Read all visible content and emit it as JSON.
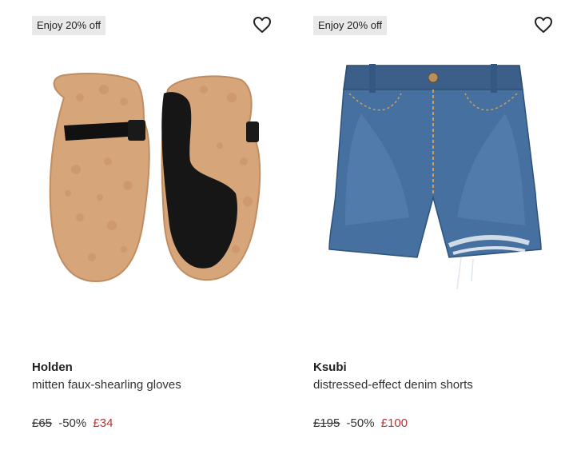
{
  "products": [
    {
      "promo": "Enjoy 20% off",
      "brand": "Holden",
      "name": "mitten faux-shearling gloves",
      "price": {
        "original": "£65",
        "discount": "-50%",
        "sale": "£34"
      },
      "image_icon": "mittens-product-image"
    },
    {
      "promo": "Enjoy 20% off",
      "brand": "Ksubi",
      "name": "distressed-effect denim shorts",
      "price": {
        "original": "£195",
        "discount": "-50%",
        "sale": "£100"
      },
      "image_icon": "denim-shorts-product-image"
    }
  ],
  "colors": {
    "sale_price": "#b33535",
    "promo_bg": "#e9e9e9"
  },
  "icons": {
    "wishlist": "heart-icon"
  }
}
